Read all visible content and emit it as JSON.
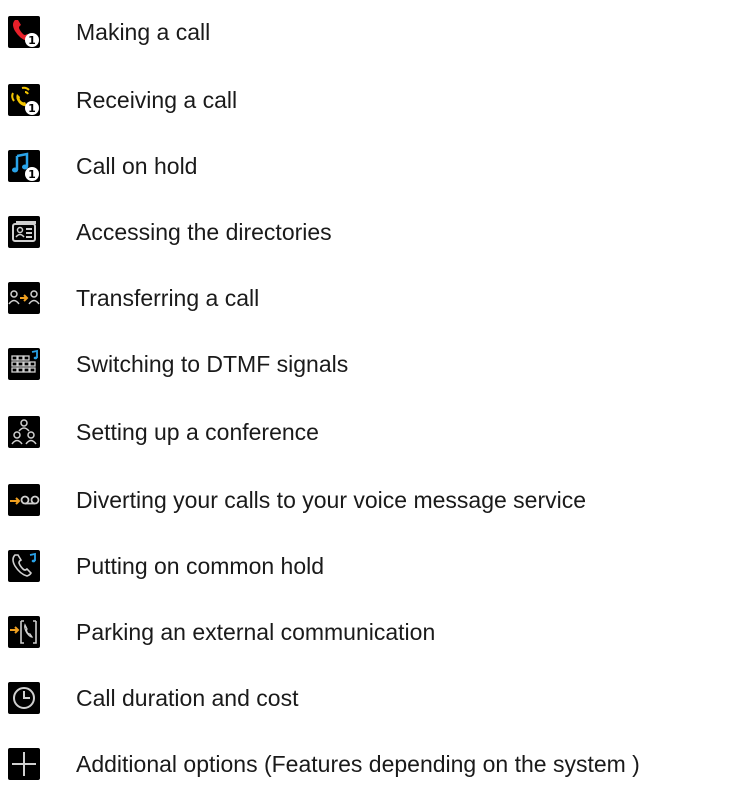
{
  "features": [
    {
      "icon": "red-handset-line1-icon",
      "label": "Making a call"
    },
    {
      "icon": "ringing-handset-line1-icon",
      "label": "Receiving a call"
    },
    {
      "icon": "music-note-line1-icon",
      "label": "Call on hold"
    },
    {
      "icon": "directory-card-icon",
      "label": "Accessing the directories"
    },
    {
      "icon": "transfer-persons-icon",
      "label": "Transferring a call"
    },
    {
      "icon": "dtmf-keypad-icon",
      "label": "Switching to DTMF signals"
    },
    {
      "icon": "conference-persons-icon",
      "label": "Setting up a conference"
    },
    {
      "icon": "voicemail-divert-icon",
      "label": "Diverting your calls to your voice message service"
    },
    {
      "icon": "handset-music-hold-icon",
      "label": "Putting on common hold"
    },
    {
      "icon": "park-call-icon",
      "label": "Parking an external communication"
    },
    {
      "icon": "clock-icon",
      "label": "Call duration and cost"
    },
    {
      "icon": "plus-icon",
      "label": "Additional options (Features depending on the system )"
    }
  ],
  "colors": {
    "icon_background": "#000000",
    "handset_red": "#e8202a",
    "ring_yellow": "#f2c400",
    "note_blue": "#2aa3e8",
    "accent_orange": "#f0a020",
    "icon_gray": "#d0d0d0",
    "text": "#1a1a1a"
  }
}
